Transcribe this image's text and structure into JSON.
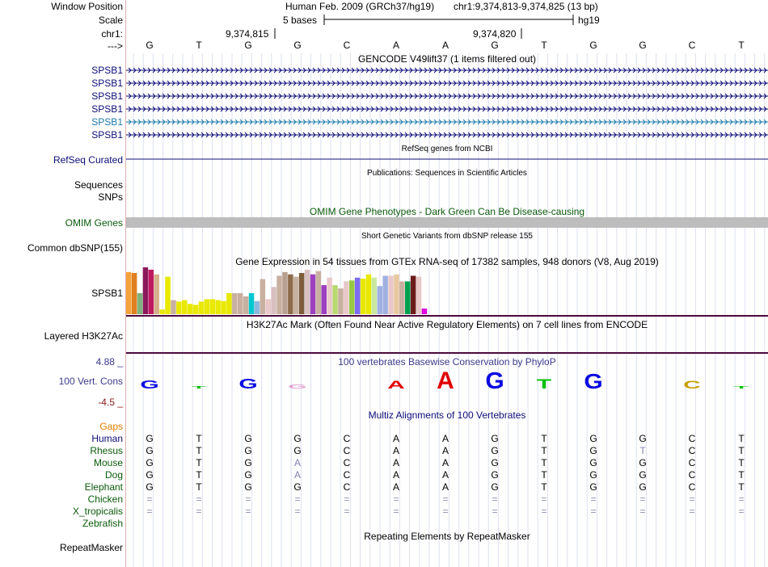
{
  "labels": {
    "window_position": "Window Position",
    "scale": "Scale",
    "chr": "chr1:",
    "strand": "--->",
    "gencode_genes": [
      "SPSB1",
      "SPSB1",
      "SPSB1",
      "SPSB1",
      "SPSB1",
      "SPSB1"
    ],
    "refseq": "RefSeq Curated",
    "sequences": "Sequences",
    "snps": "SNPs",
    "omim": "OMIM Genes",
    "dbsnp": "Common dbSNP(155)",
    "gtex": "SPSB1",
    "h3k27ac": "Layered H3K27Ac",
    "phylop_max": "4.88 _",
    "phylop_name": "100 Vert. Cons",
    "phylop_min": "-4.5 _",
    "gaps": "Gaps",
    "species": [
      "Human",
      "Rhesus",
      "Mouse",
      "Dog",
      "Elephant",
      "Chicken",
      "X_tropicalis",
      "Zebrafish"
    ],
    "repeatmasker": "RepeatMasker"
  },
  "header": {
    "assembly": "Human Feb. 2009 (GRCh37/hg19)",
    "position": "chr1:9,374,813-9,374,825 (13 bp)",
    "scale_text": "5 bases",
    "scale_db": "hg19",
    "coord_a": "9,374,815",
    "coord_b": "9,374,820"
  },
  "sequence": [
    "G",
    "T",
    "G",
    "G",
    "C",
    "A",
    "A",
    "G",
    "T",
    "G",
    "G",
    "C",
    "T"
  ],
  "tracks": {
    "gencode": "GENCODE V49lift37 (1 items filtered out)",
    "refseq": "RefSeq genes from NCBI",
    "publications": "Publications: Sequences in Scientific Articles",
    "omim": "OMIM Gene Phenotypes - Dark Green Can Be Disease-causing",
    "dbsnp": "Short Genetic Variants from dbSNP release 155",
    "gtex": "Gene Expression in 54 tissues from GTEx RNA-seq of 17382 samples, 948 donors (V8, Aug 2019)",
    "h3k27ac": "H3K27Ac Mark (Often Found Near Active Regulatory Elements) on 7 cell lines from ENCODE",
    "phylop": "100 vertebrates Basewise Conservation by PhyloP",
    "multiz": "Multiz Alignments of 100 Vertebrates",
    "repeatmasker": "Repeating Elements by RepeatMasker"
  },
  "alignment": [
    [
      "G",
      "T",
      "G",
      "G",
      "C",
      "A",
      "A",
      "G",
      "T",
      "G",
      "G",
      "C",
      "T"
    ],
    [
      "G",
      "T",
      "G",
      "G",
      "C",
      "A",
      "A",
      "G",
      "T",
      "G",
      "T",
      "C",
      "T"
    ],
    [
      "G",
      "T",
      "G",
      "A",
      "C",
      "A",
      "A",
      "G",
      "T",
      "G",
      "G",
      "C",
      "T"
    ],
    [
      "G",
      "T",
      "G",
      "A",
      "C",
      "A",
      "A",
      "G",
      "T",
      "G",
      "G",
      "C",
      "T"
    ],
    [
      "G",
      "T",
      "G",
      "G",
      "C",
      "A",
      "A",
      "G",
      "T",
      "G",
      "G",
      "C",
      "T"
    ],
    [
      "=",
      "=",
      "=",
      "=",
      "=",
      "=",
      "=",
      "=",
      "=",
      "=",
      "=",
      "=",
      "="
    ],
    [
      "=",
      "=",
      "=",
      "=",
      "=",
      "=",
      "=",
      "=",
      "=",
      "=",
      "=",
      "=",
      "="
    ]
  ],
  "colors": {
    "gencode": "#0c0c78",
    "gencode_alt": "#1b79a8",
    "refseq_label": "#0c0c78",
    "omim": "#0a5a0a",
    "phylop": "#3b3b8c",
    "gaps": "#e08000",
    "species": "#0a5a0a",
    "human": "#0c0c78",
    "h3k27ac_line": "#4b0a3c"
  },
  "chart_data": {
    "type": "bar",
    "title": "Gene Expression in 54 tissues from GTEx RNA-seq of 17382 samples, 948 donors (V8, Aug 2019)",
    "xlabel": "",
    "ylabel": "",
    "ylim": [
      0,
      1
    ],
    "values": [
      0.9,
      0.88,
      0.45,
      1.0,
      0.95,
      0.85,
      0.1,
      0.8,
      0.3,
      0.27,
      0.3,
      0.22,
      0.2,
      0.27,
      0.32,
      0.32,
      0.3,
      0.28,
      0.45,
      0.45,
      0.45,
      0.38,
      0.45,
      0.28,
      0.75,
      0.32,
      0.58,
      0.82,
      0.9,
      0.85,
      0.8,
      0.88,
      0.95,
      0.85,
      0.92,
      0.62,
      0.78,
      0.62,
      0.55,
      0.7,
      0.72,
      0.78,
      0.76,
      0.85,
      0.78,
      0.6,
      0.82,
      0.82,
      0.85,
      0.7,
      0.7,
      0.82,
      0.8,
      0.12
    ],
    "colors": [
      "#f5a23d",
      "#e08020",
      "#7fb27f",
      "#8b1a5a",
      "#c01860",
      "#d4b08c",
      "#e8e800",
      "#e8e800",
      "#c8b0a0",
      "#e8e800",
      "#e8e800",
      "#e8e800",
      "#e8e800",
      "#e8e800",
      "#e8e800",
      "#e8e800",
      "#e8e800",
      "#e8e800",
      "#e8e800",
      "#c8b0a0",
      "#c8b0a0",
      "#c8b0a0",
      "#00c8d0",
      "#8cb8e0",
      "#c8b0a0",
      "#e8c8c8",
      "#d8c0c0",
      "#c8b0a0",
      "#b8a090",
      "#8c6c4c",
      "#c8b0a0",
      "#7c5c3c",
      "#d8c0c0",
      "#9c40c0",
      "#c8b0a0",
      "#9c40c0",
      "#e8c8c8",
      "#b8d870",
      "#c8b0a0",
      "#e8c8c8",
      "#98c840",
      "#7c6cf0",
      "#e8e800",
      "#e8e800",
      "#c8e8a0",
      "#a0b0e0",
      "#a0b0e0",
      "#e8c8c8",
      "#e8c8a0",
      "#c8b0a0",
      "#00a050",
      "#6c1c1c",
      "#e8c8c8",
      "#e000e0"
    ]
  }
}
